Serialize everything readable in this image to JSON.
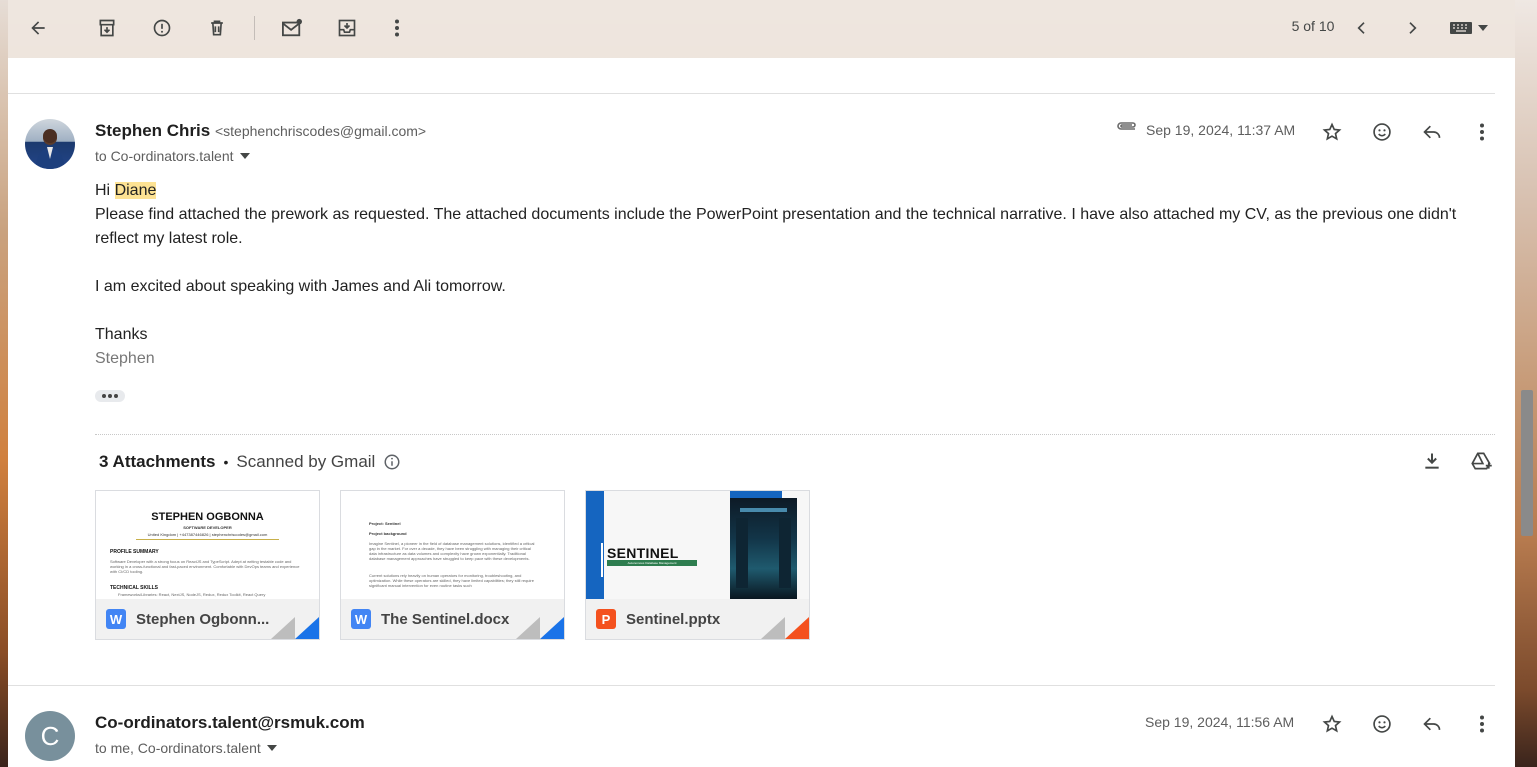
{
  "toolbar": {
    "page_count": "5 of 10"
  },
  "message1": {
    "sender_name": "Stephen Chris",
    "sender_email": "<stephenchriscodes@gmail.com>",
    "to": "to Co-ordinators.talent",
    "date": "Sep 19, 2024, 11:37 AM",
    "greeting_prefix": "Hi ",
    "greeting_name": "Diane",
    "paragraph1": "Please find attached the prework as requested. The attached documents include the PowerPoint presentation and the technical narrative. I have also attached my CV, as the previous one didn't reflect my latest role.",
    "paragraph2": "I am excited about speaking with James and Ali tomorrow.",
    "closing": "Thanks",
    "signature": "Stephen"
  },
  "attachments": {
    "count_label": "3 Attachments",
    "bullet": "•",
    "scanned_label": "Scanned by Gmail",
    "files": [
      {
        "name": "Stephen Ogbonn...",
        "type_letter": "W",
        "color": "#4285f4",
        "preview_title": "STEPHEN OGBONNA",
        "preview_subtitle": "SOFTWARE DEVELOPER",
        "preview_contact": "United Kingdom | +447387446826 | stephenchriscodes@gmail.com",
        "preview_section1": "PROFILE SUMMARY",
        "preview_summary": "Software Developer with a strong focus on ReactJS and TypeScript. Adept at writing testable code and working in a cross-functional and fast-paced environment. Comfortable with DevOps teams and experience with CI/CD tooling.",
        "preview_section2": "TECHNICAL SKILLS",
        "preview_skills": "Frameworks/Libraries: React, NextJS, NodeJS, Redux, Redux Toolkit, React Query"
      },
      {
        "name": "The Sentinel.docx",
        "type_letter": "W",
        "color": "#4285f4",
        "preview_line1": "Project: Sentinel",
        "preview_line2": "Project background",
        "preview_para1": "Imagine Sentinel, a pioneer in the field of database management solutions, identified a critical gap in the market. For over a decade, they have been struggling with managing their critical data infrastructure as data volumes and complexity have grown exponentially. Traditional database management approaches have struggled to keep pace with these developments.",
        "preview_para2": "Current solutions rely heavily on human operators for monitoring, troubleshooting, and optimization. While these operators are skilled, they have limited capabilities; they still require significant manual intervention for even routine tasks such"
      },
      {
        "name": "Sentinel.pptx",
        "type_letter": "P",
        "color": "#f4511e",
        "preview_title": "SENTINEL",
        "preview_subtitle": "Autonomous Database Management"
      }
    ]
  },
  "message2": {
    "avatar_letter": "C",
    "sender_name": "Co-ordinators.talent@rsmuk.com",
    "to": "to me, Co-ordinators.talent",
    "date": "Sep 19, 2024, 11:56 AM"
  },
  "colors": {
    "highlight": "#fde293",
    "word_blue": "#4285f4",
    "ppt_orange": "#f4511e"
  },
  "icons": [
    "back-arrow-icon",
    "archive-icon",
    "report-spam-icon",
    "delete-icon",
    "mark-unread-icon",
    "move-to-icon",
    "more-vert-icon",
    "chevron-left-icon",
    "chevron-right-icon",
    "keyboard-icon",
    "attachment-icon",
    "star-icon",
    "emoji-icon",
    "reply-icon",
    "download-all-icon",
    "add-to-drive-icon",
    "info-icon"
  ]
}
